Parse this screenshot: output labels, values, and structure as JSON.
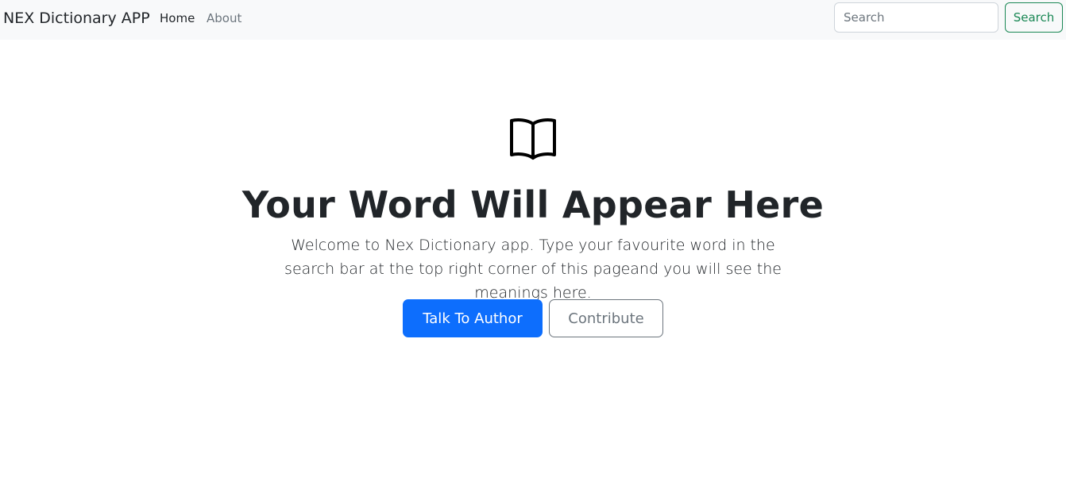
{
  "navbar": {
    "brand": "NEX Dictionary APP",
    "links": [
      {
        "label": "Home",
        "active": true
      },
      {
        "label": "About",
        "active": false
      }
    ],
    "search": {
      "placeholder": "Search",
      "value": "",
      "button_label": "Search"
    }
  },
  "hero": {
    "icon": "book-icon",
    "title": "Your Word Will Appear Here",
    "description": "Welcome to Nex Dictionary app. Type your favourite word in the search bar at the top right corner of this pageand you will see the meanings here.",
    "primary_button": "Talk To Author",
    "secondary_button": "Contribute"
  },
  "colors": {
    "navbar_bg": "#f8f9fa",
    "primary": "#0d6efd",
    "success": "#198754",
    "secondary": "#6c757d",
    "text": "#212529"
  }
}
